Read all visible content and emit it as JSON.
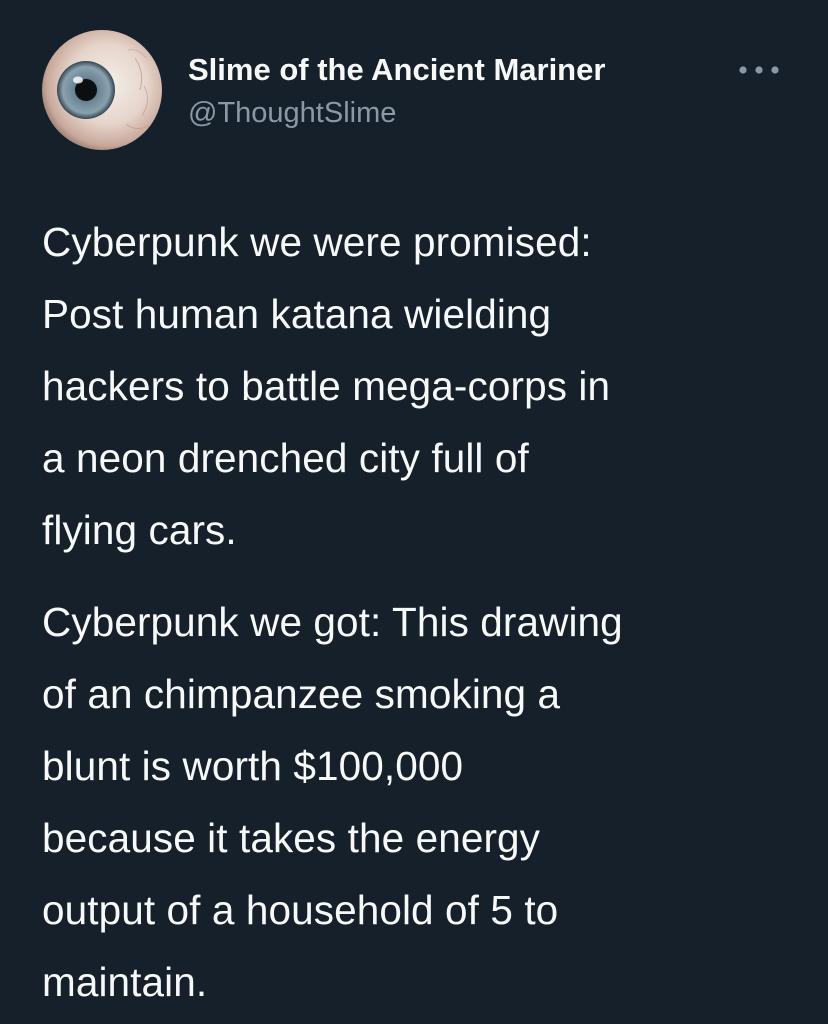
{
  "tweet": {
    "author": {
      "display_name": "Slime of the Ancient Mariner",
      "handle": "@ThoughtSlime",
      "avatar_icon": "eyeball-icon"
    },
    "more_icon": "more-options-icon",
    "paragraphs": [
      "Cyberpunk we were promised:\nPost human katana wielding\nhackers to battle mega-corps in\na neon drenched city full of\nflying cars.",
      "Cyberpunk we got: This drawing\nof an chimpanzee smoking a\nblunt is worth $100,000\nbecause it takes the energy\noutput of a household of 5 to\nmaintain."
    ]
  },
  "colors": {
    "background": "#15202b",
    "primary_text": "#f7f9f9",
    "secondary_text": "#8b98a5"
  }
}
